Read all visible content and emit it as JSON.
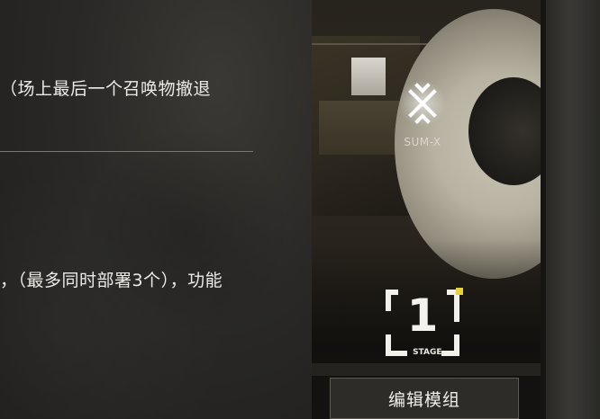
{
  "description": {
    "line1": "（场上最后一个召唤物撤退",
    "line2": "，（最多同时部署3个），功能"
  },
  "module": {
    "name": "SUM-X",
    "icon": "sum-x-emblem-icon",
    "stage_number": "1",
    "stage_label": "STAGE."
  },
  "actions": {
    "edit_label": "编辑模组"
  },
  "colors": {
    "accent_yellow": "#e8d23a",
    "text": "#ecebe7",
    "panel_bg": "#2a2927"
  }
}
